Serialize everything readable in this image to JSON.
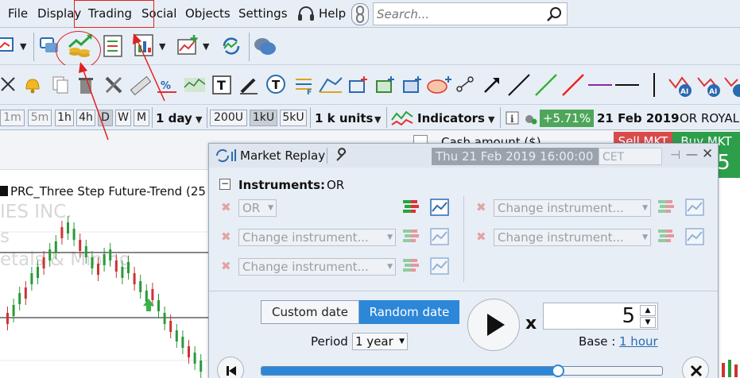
{
  "menu": {
    "items": [
      "File",
      "Display",
      "Trading",
      "Social",
      "Objects",
      "Settings"
    ],
    "help": "Help"
  },
  "search": {
    "placeholder": "Search..."
  },
  "timeframe": {
    "buttons": [
      "1m",
      "5m",
      "1h",
      "4h",
      "D",
      "W",
      "M"
    ],
    "period": "1 day",
    "units": [
      "200U",
      "1kU",
      "5kU"
    ],
    "units_select": "1 k units",
    "indicators": "Indicators",
    "change_pct": "+5.71%",
    "date": "21 Feb 2019",
    "symbol": "OR ROYAL"
  },
  "chart": {
    "title": "PRC_Three Step Future-Trend (25",
    "watermark": [
      "IES INC.",
      "s",
      "etals & Mining"
    ],
    "cash_label": "Cash amount ($)",
    "sell_label": "Sell MKT",
    "buy_label": "Buy MKT"
  },
  "replay": {
    "title": "Market Replay",
    "datetime": "Thu 21 Feb 2019 16:00:00",
    "timezone": "CET",
    "instruments_label": "Instruments:",
    "instruments_value": "OR",
    "first_instrument": "OR",
    "placeholder_instrument": "Change instrument...",
    "custom_date": "Custom date",
    "random_date": "Random date",
    "period_label": "Period",
    "period_value": "1 year",
    "multiplier": "x",
    "speed": "5",
    "base_label": "Base :",
    "base_value": "1 hour",
    "progress": 0.74
  },
  "colors": {
    "accent": "#2c87d8",
    "positive": "#4ea65a",
    "sell": "#d94b4b",
    "buy": "#2d9f4a",
    "annotation": "#e02020"
  }
}
